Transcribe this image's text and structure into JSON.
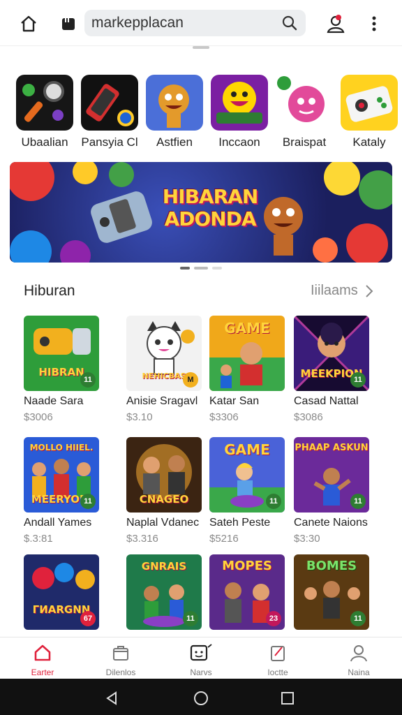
{
  "header": {
    "search_value": "markepplacan",
    "search_placeholder": "markepplacan"
  },
  "categories": [
    {
      "label": "Ubaalian",
      "icon": "magnifier-icon",
      "color": "#1a1a1a"
    },
    {
      "label": "Pansyia Cl",
      "icon": "phone-icon",
      "color": "#111111"
    },
    {
      "label": "Astfien",
      "icon": "monster-icon",
      "color": "#4b6fd8"
    },
    {
      "label": "Inccaon",
      "icon": "smiley-icon",
      "color": "#7b1fa2"
    },
    {
      "label": "Braispat",
      "icon": "cat-icon",
      "color": "#ffffff"
    },
    {
      "label": "Kataly",
      "icon": "gamepad-icon",
      "color": "#ffd21f"
    }
  ],
  "banner": {
    "title_line1": "HIBARAN",
    "title_line2": "ADONDA"
  },
  "section": {
    "title": "Hiburan",
    "more_label": "Iiilaams"
  },
  "games": [
    {
      "name": "Naade Sara",
      "price": "$3006",
      "thumb_text": "HIBRAN",
      "badge": "11",
      "bg": "#2e9d3a"
    },
    {
      "name": "Anisie Sragavl",
      "price": "$3.10",
      "thumb_text": "NEHICBAS",
      "badge": "M",
      "bg": "#f2f2f2"
    },
    {
      "name": "Katar San",
      "price": "$3306",
      "thumb_text": "GAME",
      "badge": "",
      "bg": "#f0a81a"
    },
    {
      "name": "Casad Nattal",
      "price": "$3086",
      "thumb_text": "MEEKPION",
      "badge": "11",
      "bg": "#3a1c7a"
    },
    {
      "name": "Andall Yames",
      "price": "$.3:81",
      "thumb_text": "MEERYORI",
      "badge": "11",
      "bg": "#2a5bd7"
    },
    {
      "name": "Naplal Vdanec",
      "price": "$3.316",
      "thumb_text": "CNAGEO",
      "badge": "",
      "bg": "#3b2412"
    },
    {
      "name": "Sateh Peste",
      "price": "$5216",
      "thumb_text": "GAME",
      "badge": "11",
      "bg": "#4a62d8"
    },
    {
      "name": "Canete Naions",
      "price": "$3:30",
      "thumb_text": "PHAAP ASKUN",
      "badge": "11",
      "bg": "#6b2a9a"
    },
    {
      "name": "",
      "price": "",
      "thumb_text": "ГИARGNN",
      "badge": "67",
      "bg": "#1f2a6a"
    },
    {
      "name": "",
      "price": "",
      "thumb_text": "GNRAIS",
      "badge": "11",
      "bg": "#1f7a4a"
    },
    {
      "name": "",
      "price": "",
      "thumb_text": "MOPES",
      "badge": "23",
      "bg": "#5a2a8a"
    },
    {
      "name": "",
      "price": "",
      "thumb_text": "BOMES",
      "badge": "11",
      "bg": "#5a3a12"
    }
  ],
  "bottom_nav": [
    {
      "label": "Earter",
      "icon": "home-icon",
      "active": true
    },
    {
      "label": "Dilenlos",
      "icon": "shop-icon",
      "active": false
    },
    {
      "label": "Narvs",
      "icon": "game-icon",
      "active": false
    },
    {
      "label": "Ioctte",
      "icon": "edit-icon",
      "active": false
    },
    {
      "label": "Naina",
      "icon": "profile-icon",
      "active": false
    }
  ],
  "colors": {
    "accent": "#e0223c",
    "banner_title": "#ffd43b"
  }
}
